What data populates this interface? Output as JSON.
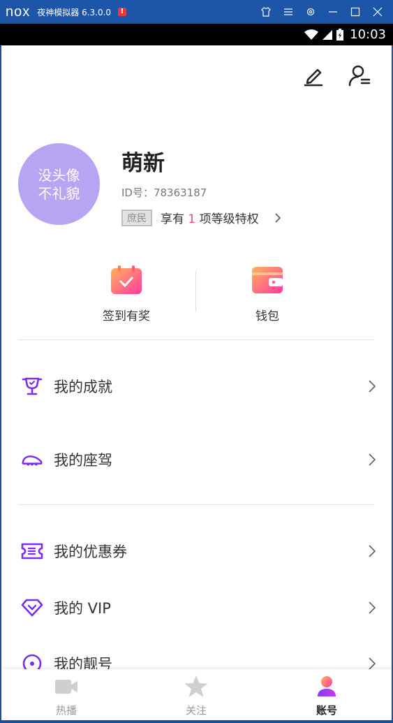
{
  "emulator": {
    "logo": "nox",
    "title": "夜神模拟器 6.3.0.0",
    "warning": "!"
  },
  "status_bar": {
    "time": "10:03"
  },
  "profile": {
    "avatar_text_line1": "没头像",
    "avatar_text_line2": "不礼貌",
    "nickname": "萌新",
    "id_text": "ID号：78363187",
    "rank_badge": "庶民",
    "privilege_prefix": "享有",
    "privilege_count": "1",
    "privilege_suffix": "项等级特权"
  },
  "quick_actions": {
    "checkin": "签到有奖",
    "wallet": "钱包"
  },
  "menu": {
    "achievements": "我的成就",
    "mount": "我的座驾",
    "coupons": "我的优惠券",
    "vip": "我的 VIP",
    "pretty_id": "我的靓号"
  },
  "bottom_nav": {
    "hot": "热播",
    "follow": "关注",
    "account": "账号"
  },
  "colors": {
    "accent_purple": "#7b2cf0",
    "avatar_bg": "#b7a5f4",
    "highlight_red": "#f04c7a"
  }
}
